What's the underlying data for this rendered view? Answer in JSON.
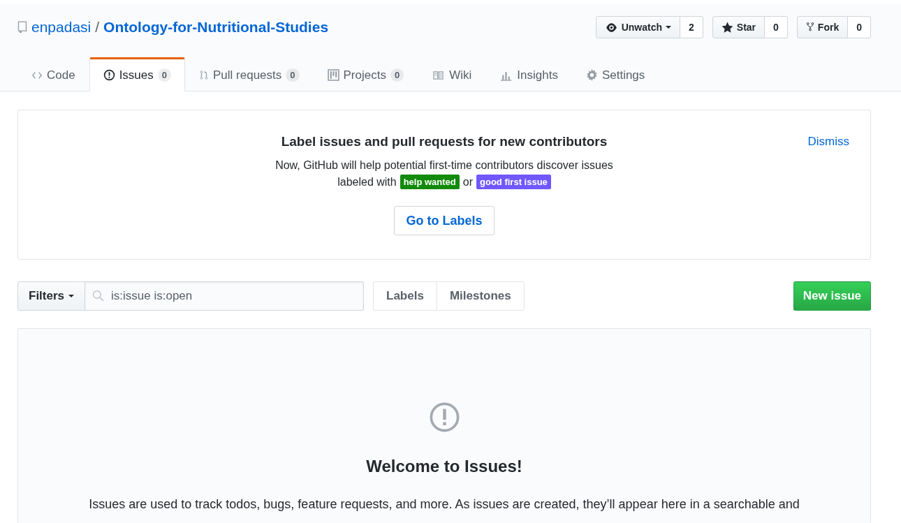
{
  "repo": {
    "owner": "enpadasi",
    "separator": "/",
    "name": "Ontology-for-Nutritional-Studies"
  },
  "header_buttons": [
    {
      "kind": "watch",
      "label": "Unwatch",
      "dropdown": true,
      "count": "2"
    },
    {
      "kind": "star",
      "label": "Star",
      "dropdown": false,
      "count": "0"
    },
    {
      "kind": "fork",
      "label": "Fork",
      "dropdown": false,
      "count": "0"
    }
  ],
  "tabs": [
    {
      "kind": "code",
      "label": "Code",
      "selected": false
    },
    {
      "kind": "issues",
      "label": "Issues",
      "count": "0",
      "selected": true
    },
    {
      "kind": "pulls",
      "label": "Pull requests",
      "count": "0",
      "selected": false
    },
    {
      "kind": "projects",
      "label": "Projects",
      "count": "0",
      "selected": false
    },
    {
      "kind": "wiki",
      "label": "Wiki",
      "selected": false
    },
    {
      "kind": "insights",
      "label": "Insights",
      "selected": false
    },
    {
      "kind": "settings",
      "label": "Settings",
      "selected": false
    }
  ],
  "banner": {
    "title": "Label issues and pull requests for new contributors",
    "text": "Now, GitHub will help potential first-time contributors discover issues",
    "labeled_with": "labeled with",
    "labels": [
      {
        "name": "help wanted",
        "color": "#128a0c"
      },
      {
        "name": "good first issue",
        "color": "#7057ff"
      }
    ],
    "or": "or",
    "button": "Go to Labels",
    "dismiss": "Dismiss"
  },
  "filter_bar": {
    "filters": "Filters",
    "search": "is:issue is:open",
    "buttons": [
      "Labels",
      "Milestones"
    ],
    "new_issue": "New issue"
  },
  "blankslate": {
    "title": "Welcome to Issues!",
    "text": "Issues are used to track todos, bugs, feature requests, and more. As issues are created, they’ll appear here in a searchable and"
  }
}
